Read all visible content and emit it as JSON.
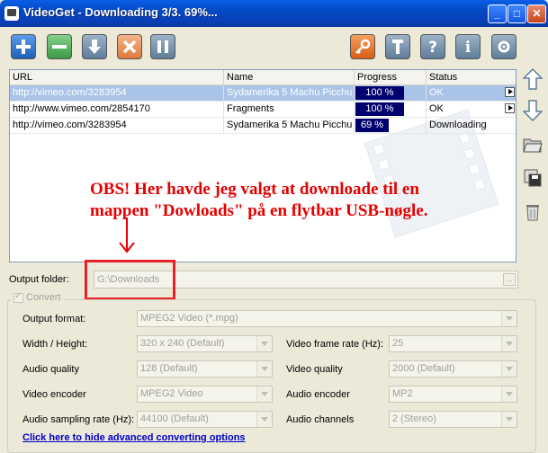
{
  "window": {
    "title": "VideoGet - Downloading 3/3. 69%...",
    "minimize_label": "_",
    "maximize_label": "□",
    "close_label": "✕"
  },
  "toolbar": {
    "buttons": [
      "add-icon",
      "remove-icon",
      "download-icon",
      "stop-icon",
      "pause-icon"
    ],
    "right_buttons": [
      "key-icon",
      "settings-icon",
      "help-icon",
      "info-icon",
      "tools-icon"
    ],
    "colors": {
      "blue_button": "#2f6fc2",
      "green_button": "#4fae5a",
      "orange_button": "#e07b2f",
      "gray_button": "#6e8aa3"
    }
  },
  "table": {
    "columns": [
      "URL",
      "Name",
      "Progress",
      "Status"
    ],
    "rows": [
      {
        "url": "http://vimeo.com/3283954",
        "name": "Sydamerika 5 Machu Picchu",
        "progress": "100 %",
        "progress_value": 100,
        "status": "OK",
        "selected": true
      },
      {
        "url": "http://www.vimeo.com/2854170",
        "name": "Fragments",
        "progress": "100 %",
        "progress_value": 100,
        "status": "OK",
        "selected": false
      },
      {
        "url": "http://vimeo.com/3283954",
        "name": "Sydamerika 5 Machu Picchu",
        "progress": "69 %",
        "progress_value": 69,
        "status": "Downloading",
        "selected": false
      }
    ]
  },
  "side_buttons": [
    "move-up-icon",
    "move-down-icon",
    "open-folder-icon",
    "save-list-icon",
    "trash-icon"
  ],
  "annotation": {
    "line1": "OBS! Her havde jeg valgt at downloade til en",
    "line2": "mappen \"Dowloads\" på en flytbar USB-nøgle.",
    "color": "#e60000"
  },
  "output": {
    "label": "Output folder:",
    "value": "G:\\Downloads",
    "browse_label": "..."
  },
  "convert": {
    "label": "Convert",
    "checked": true,
    "output_format_label": "Output format:",
    "output_format_value": "MPEG2 Video (*.mpg)",
    "width_height_label": "Width / Height:",
    "width_height_value": "320 x 240 (Default)",
    "video_frame_rate_label": "Video frame rate (Hz):",
    "video_frame_rate_value": "25",
    "audio_quality_label": "Audio quality",
    "audio_quality_value": "128 (Default)",
    "video_quality_label": "Video quality",
    "video_quality_value": "2000 (Default)",
    "video_encoder_label": "Video encoder",
    "video_encoder_value": "MPEG2 Video",
    "audio_encoder_label": "Audio encoder",
    "audio_encoder_value": "MP2",
    "audio_sampling_label": "Audio sampling rate (Hz):",
    "audio_sampling_value": "44100 (Default)",
    "audio_channels_label": "Audio channels",
    "audio_channels_value": "2 (Stereo)",
    "hide_link": "Click here to hide advanced converting options"
  }
}
